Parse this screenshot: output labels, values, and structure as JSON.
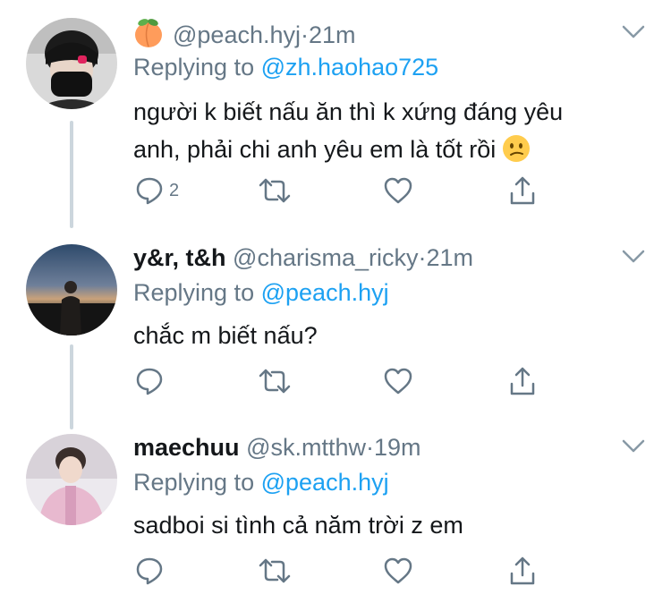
{
  "colors": {
    "text": "#14171a",
    "secondary": "#657786",
    "link": "#1da1f2",
    "thread_line": "#ccd6dd",
    "divider": "#e1e8ed"
  },
  "tweets": [
    {
      "badge_icon": "peach-emoji-icon",
      "name": "",
      "handle": "@peach.hyj",
      "dot": "·",
      "time": "21m",
      "replying_prefix": "Replying to",
      "replying_to": "@zh.haohao725",
      "text_line1": "người k biết nấu ăn thì k xứng đáng yêu",
      "text_line2": "anh, phải chi anh yêu em là tốt rồi",
      "text_emoji": "confused-face-emoji-icon",
      "reply_count": "2"
    },
    {
      "name": "y&r, t&h",
      "handle": "@charisma_ricky",
      "dot": "·",
      "time": "21m",
      "replying_prefix": "Replying to",
      "replying_to": "@peach.hyj",
      "text": "chắc m biết nấu?",
      "reply_count": ""
    },
    {
      "name": "maechuu",
      "handle": "@sk.mtthw",
      "dot": "·",
      "time": "19m",
      "replying_prefix": "Replying to",
      "replying_to": "@peach.hyj",
      "text": "sadboi si tình cả năm trời z em",
      "reply_count": ""
    }
  ]
}
